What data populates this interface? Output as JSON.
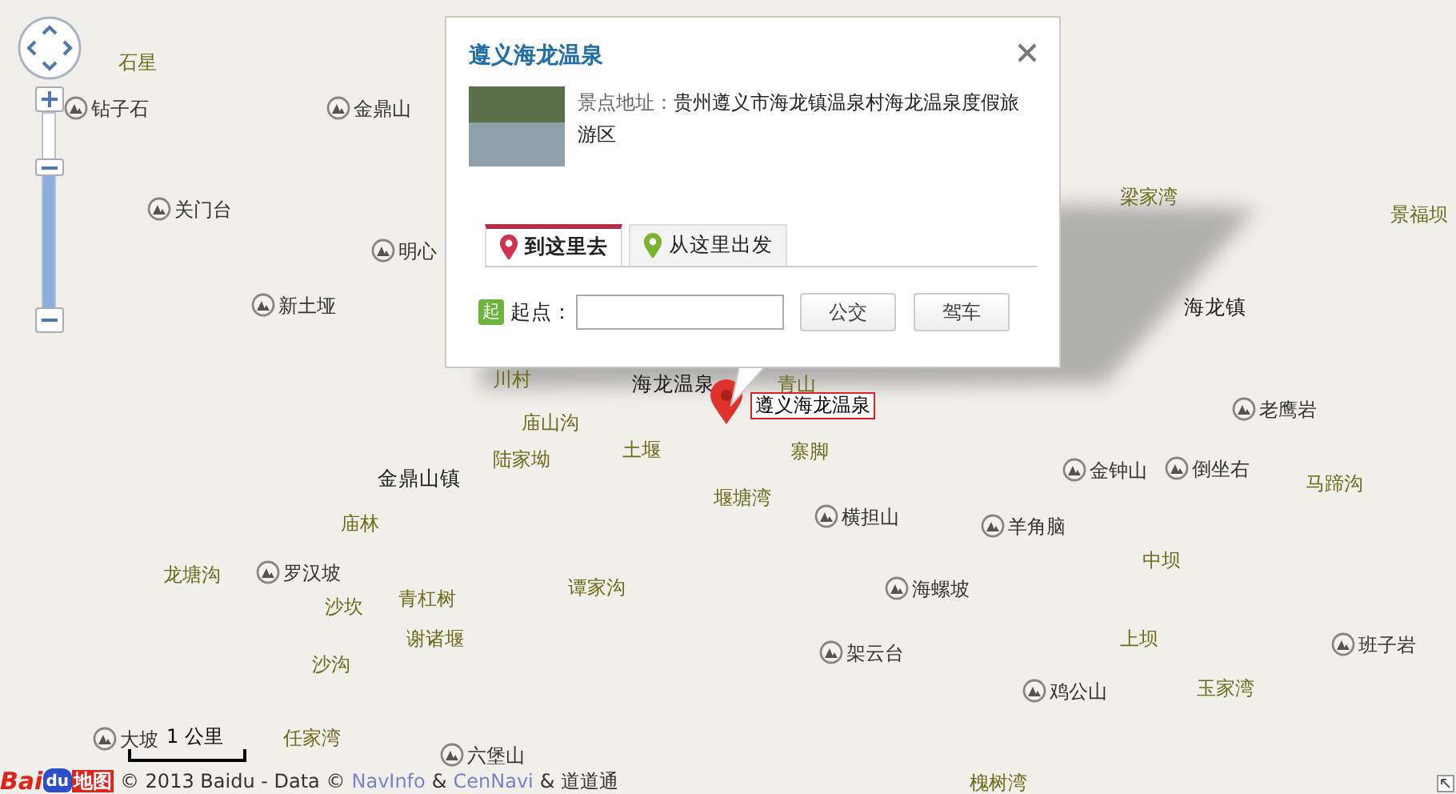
{
  "map": {
    "labels": [
      {
        "kind": "village",
        "text": "石星"
      },
      {
        "kind": "poi",
        "text": "钻子石"
      },
      {
        "kind": "poi",
        "text": "金鼎山"
      },
      {
        "kind": "poi",
        "text": "关门台"
      },
      {
        "kind": "poi",
        "text": "明心"
      },
      {
        "kind": "poi",
        "text": "新土垭"
      },
      {
        "kind": "village",
        "text": "梁家湾"
      },
      {
        "kind": "village",
        "text": "景福坝"
      },
      {
        "kind": "town",
        "text": "海龙镇"
      },
      {
        "kind": "village",
        "text": "川村"
      },
      {
        "kind": "town",
        "text": "海龙温泉"
      },
      {
        "kind": "village",
        "text": "青山"
      },
      {
        "kind": "village",
        "text": "庙山沟"
      },
      {
        "kind": "poi",
        "text": "老鹰岩"
      },
      {
        "kind": "village",
        "text": "陆家坳"
      },
      {
        "kind": "village",
        "text": "土堰"
      },
      {
        "kind": "village",
        "text": "寨脚"
      },
      {
        "kind": "town",
        "text": "金鼎山镇"
      },
      {
        "kind": "poi",
        "text": "金钟山"
      },
      {
        "kind": "poi",
        "text": "倒坐右"
      },
      {
        "kind": "village",
        "text": "马蹄沟"
      },
      {
        "kind": "village",
        "text": "堰塘湾"
      },
      {
        "kind": "village",
        "text": "庙林"
      },
      {
        "kind": "poi",
        "text": "横担山"
      },
      {
        "kind": "poi",
        "text": "羊角脑"
      },
      {
        "kind": "village",
        "text": "龙塘沟"
      },
      {
        "kind": "poi",
        "text": "罗汉坡"
      },
      {
        "kind": "village",
        "text": "中坝"
      },
      {
        "kind": "village",
        "text": "沙坎"
      },
      {
        "kind": "village",
        "text": "青杠树"
      },
      {
        "kind": "village",
        "text": "谭家沟"
      },
      {
        "kind": "poi",
        "text": "海螺坡"
      },
      {
        "kind": "village",
        "text": "谢诸堰"
      },
      {
        "kind": "village",
        "text": "上坝"
      },
      {
        "kind": "poi",
        "text": "班子岩"
      },
      {
        "kind": "village",
        "text": "沙沟"
      },
      {
        "kind": "poi",
        "text": "架云台"
      },
      {
        "kind": "poi",
        "text": "鸡公山"
      },
      {
        "kind": "village",
        "text": "玉家湾"
      },
      {
        "kind": "poi",
        "text": "大坡"
      },
      {
        "kind": "village",
        "text": "任家湾"
      },
      {
        "kind": "poi",
        "text": "六堡山"
      },
      {
        "kind": "village",
        "text": "槐树湾"
      }
    ]
  },
  "marker": {
    "label": "遵义海龙温泉"
  },
  "zoom": {
    "level": 0.7
  },
  "popup": {
    "title": "遵义海龙温泉",
    "address_label": "景点地址：",
    "address": "贵州遵义市海龙镇温泉村海龙温泉度假旅游区",
    "tabs": [
      {
        "label": "到这里去",
        "selected": true,
        "color": "#d0324f"
      },
      {
        "label": "从这里出发",
        "selected": false,
        "color": "#7ab42e"
      }
    ],
    "start_badge": "起",
    "start_label": "起点：",
    "buttons": [
      "公交",
      "驾车"
    ]
  },
  "footer": {
    "logo_left": "Bai",
    "logo_paw": "du",
    "logo_right": "地图",
    "copyright": "© 2013 Baidu - Data ©",
    "links": [
      "NavInfo",
      "CenNavi"
    ],
    "separator": "&",
    "tail": "& 道道通"
  },
  "scale": {
    "label": "1 公里"
  }
}
